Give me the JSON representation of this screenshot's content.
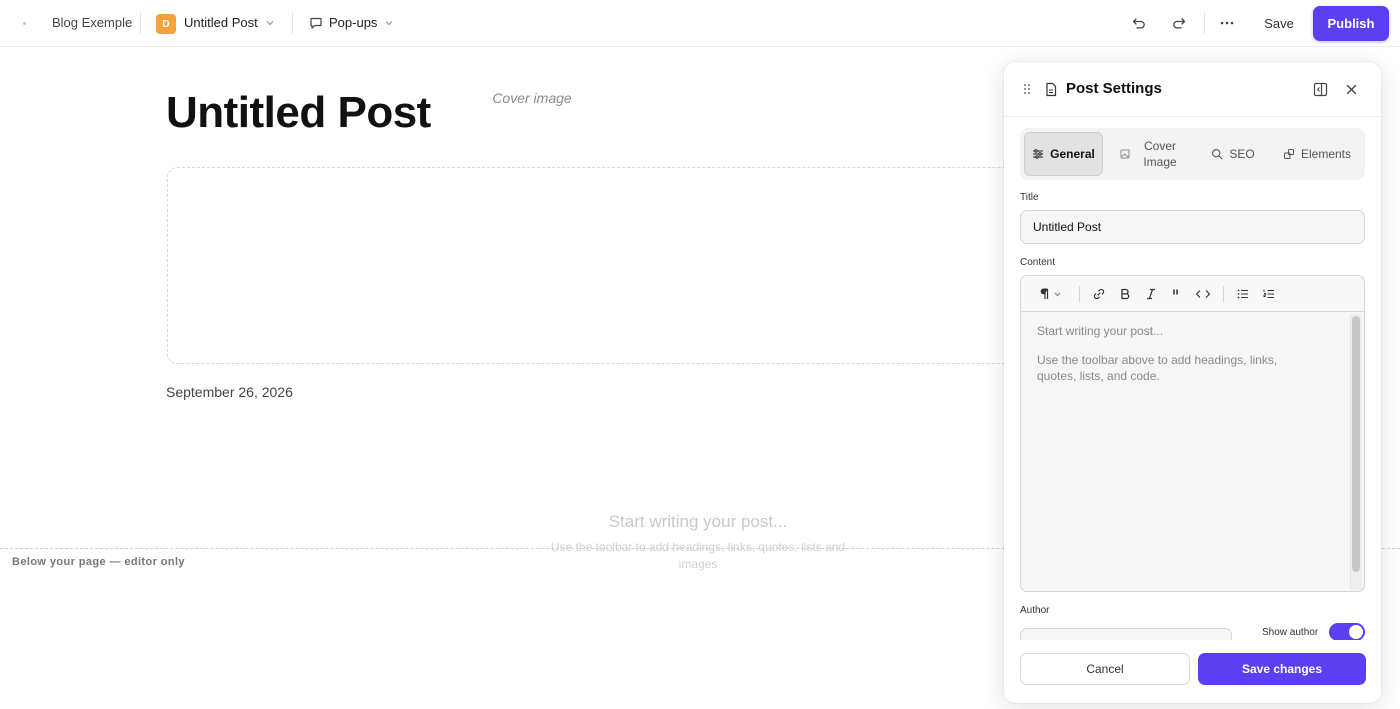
{
  "topbar": {
    "site_name": "Blog Exemple",
    "page_badge": "D",
    "page_name": "Untitled Post",
    "popups_label": "Pop-ups",
    "save_label": "Save",
    "publish_label": "Publish",
    "icons": [
      "dot-icon",
      "chevron-down-icon",
      "message-square-icon",
      "undo-icon",
      "redo-icon",
      "more-horizontal-icon"
    ]
  },
  "canvas": {
    "post_title": "Untitled Post",
    "cover_label": "Cover image",
    "post_date": "September 26, 2026",
    "content_placeholder": "Start writing your post...",
    "content_hint": "Use the toolbar to add headings, links, quotes, lists and images",
    "fold_label": "Below your page — editor only"
  },
  "panel": {
    "title": "Post Settings",
    "icons": [
      "grip-icon",
      "document-icon",
      "split-view-icon",
      "close-icon"
    ],
    "tabs": [
      {
        "label": "General",
        "icon": "sliders-icon",
        "active": true
      },
      {
        "label": "Cover Image",
        "icon": "image-icon",
        "active": false
      },
      {
        "label": "SEO",
        "icon": "search-icon",
        "active": false
      },
      {
        "label": "Elements",
        "icon": "elements-icon",
        "active": false
      }
    ],
    "title_field": {
      "label": "Title",
      "value": "Untitled Post"
    },
    "content_field": {
      "label": "Content",
      "placeholder": "Start writing your post...",
      "hint": "Use the toolbar above to add headings, links, quotes, lists, and code.",
      "toolbar": [
        "paragraph-icon",
        "link-icon",
        "bold-icon",
        "italic-icon",
        "quote-icon",
        "code-icon",
        "bullet-list-icon",
        "numbered-list-icon"
      ]
    },
    "author_field": {
      "label": "Author",
      "value": ""
    },
    "show_author": {
      "label": "Show author",
      "on": true
    },
    "cancel_label": "Cancel",
    "save_changes_label": "Save changes"
  },
  "colors": {
    "accent": "#5b3ff0",
    "badge": "#f5a23a"
  }
}
